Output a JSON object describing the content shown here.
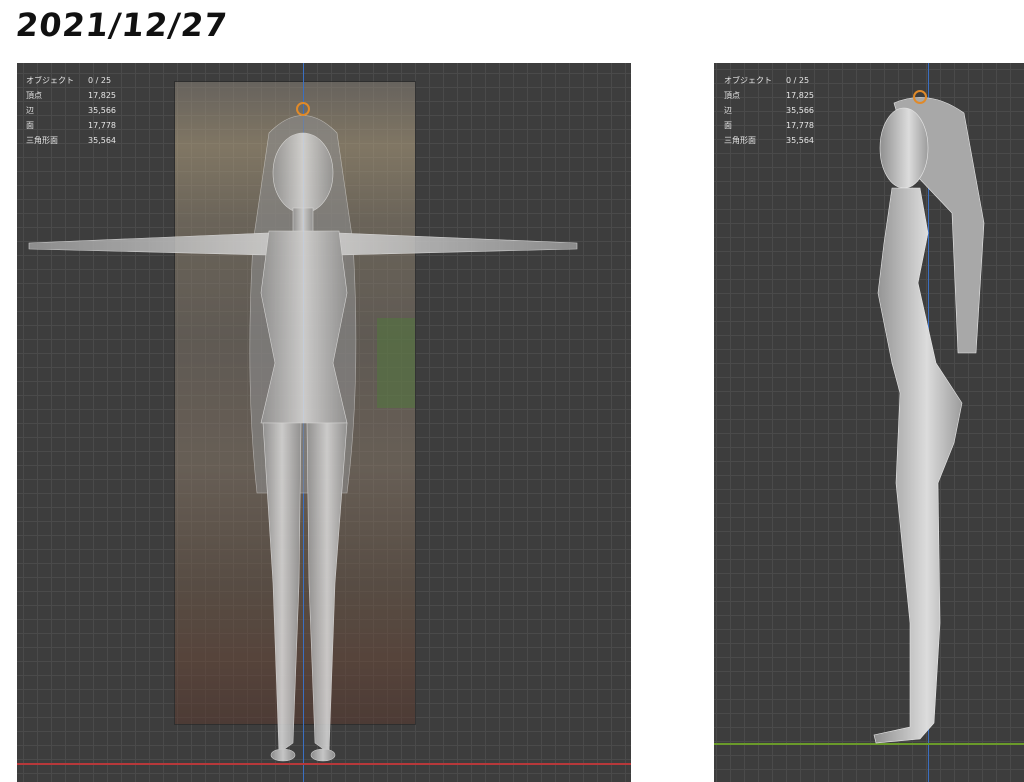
{
  "page": {
    "date": "2021/12/27"
  },
  "viewports": {
    "front": {
      "stats": [
        {
          "label": "オブジェクト",
          "value": "0 / 25"
        },
        {
          "label": "頂点",
          "value": "17,825"
        },
        {
          "label": "辺",
          "value": "35,566"
        },
        {
          "label": "面",
          "value": "17,778"
        },
        {
          "label": "三角形面",
          "value": "35,564"
        }
      ]
    },
    "side": {
      "stats": [
        {
          "label": "オブジェクト",
          "value": "0 / 25"
        },
        {
          "label": "頂点",
          "value": "17,825"
        },
        {
          "label": "辺",
          "value": "35,566"
        },
        {
          "label": "面",
          "value": "17,778"
        },
        {
          "label": "三角形面",
          "value": "35,564"
        }
      ]
    }
  },
  "colors": {
    "viewport_bg": "#3d3d3d",
    "grid": "#4a4a4a",
    "axis_x": "#b7383a",
    "axis_y": "#6a9a2a",
    "axis_z": "#3a6fc2",
    "mesh": "#c9c9c9"
  }
}
